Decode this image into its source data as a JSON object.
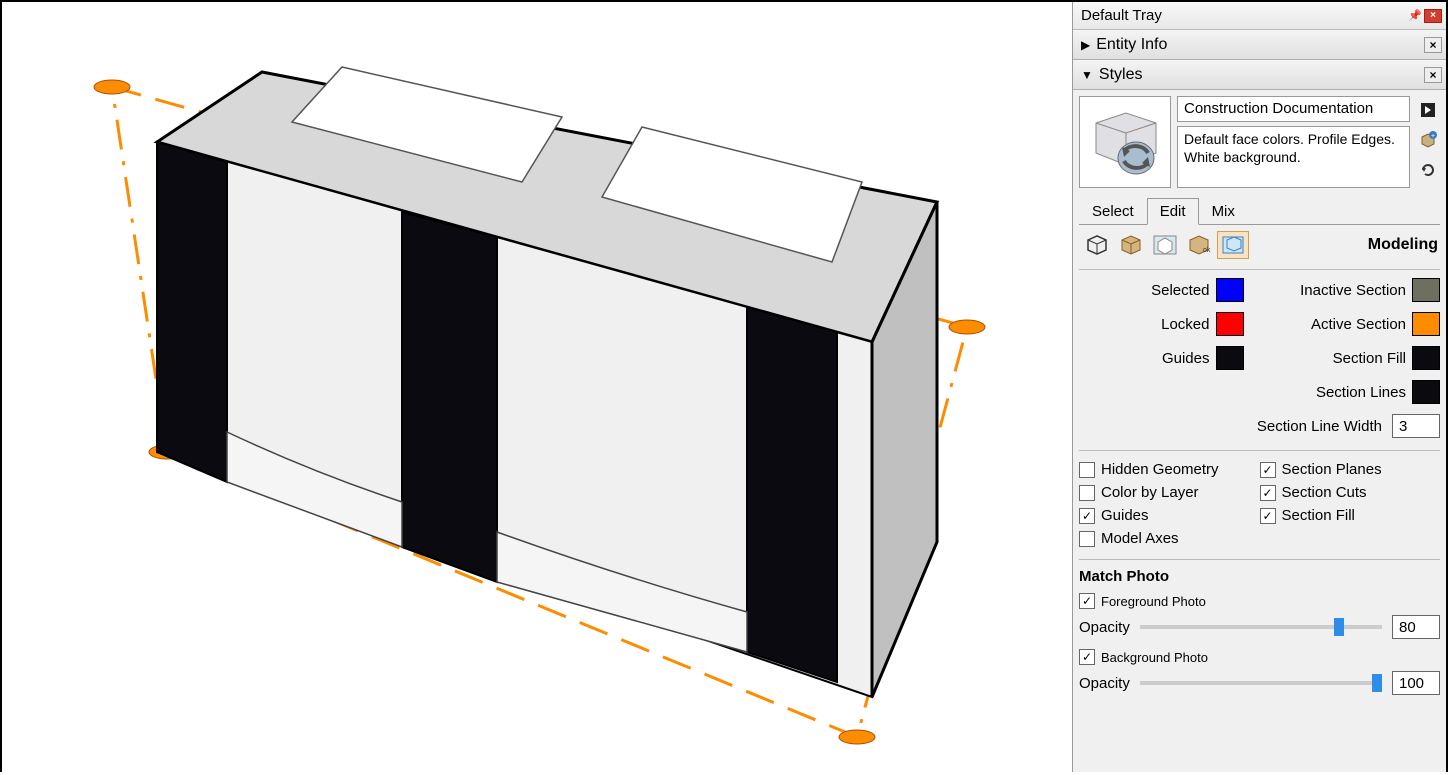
{
  "tray": {
    "title": "Default Tray"
  },
  "panels": {
    "entity_info": {
      "label": "Entity Info"
    },
    "styles": {
      "label": "Styles",
      "style_name": "Construction Documentation",
      "style_desc": "Default face colors. Profile Edges. White background."
    }
  },
  "tabs": {
    "select": "Select",
    "edit": "Edit",
    "mix": "Mix"
  },
  "section_title": "Modeling",
  "colors": {
    "selected": {
      "label": "Selected",
      "hex": "#0000ff"
    },
    "locked": {
      "label": "Locked",
      "hex": "#ff0000"
    },
    "guides": {
      "label": "Guides",
      "hex": "#0a0a0f"
    },
    "inactive_section": {
      "label": "Inactive Section",
      "hex": "#6f6f60"
    },
    "active_section": {
      "label": "Active Section",
      "hex": "#ff8c00"
    },
    "section_fill": {
      "label": "Section Fill",
      "hex": "#0a0a0f"
    },
    "section_lines": {
      "label": "Section Lines",
      "hex": "#0a0a0f"
    }
  },
  "section_line_width": {
    "label": "Section Line Width",
    "value": "3"
  },
  "checkboxes": {
    "hidden_geometry": {
      "label": "Hidden Geometry",
      "checked": false
    },
    "color_by_layer": {
      "label": "Color by Layer",
      "checked": false
    },
    "guides": {
      "label": "Guides",
      "checked": true
    },
    "model_axes": {
      "label": "Model Axes",
      "checked": false
    },
    "section_planes": {
      "label": "Section Planes",
      "checked": true
    },
    "section_cuts": {
      "label": "Section Cuts",
      "checked": true
    },
    "section_fill": {
      "label": "Section Fill",
      "checked": true
    }
  },
  "match_photo": {
    "title": "Match Photo",
    "foreground": {
      "label": "Foreground Photo",
      "checked": true
    },
    "background": {
      "label": "Background Photo",
      "checked": true
    },
    "opacity_label": "Opacity",
    "fg_opacity": "80",
    "bg_opacity": "100"
  }
}
